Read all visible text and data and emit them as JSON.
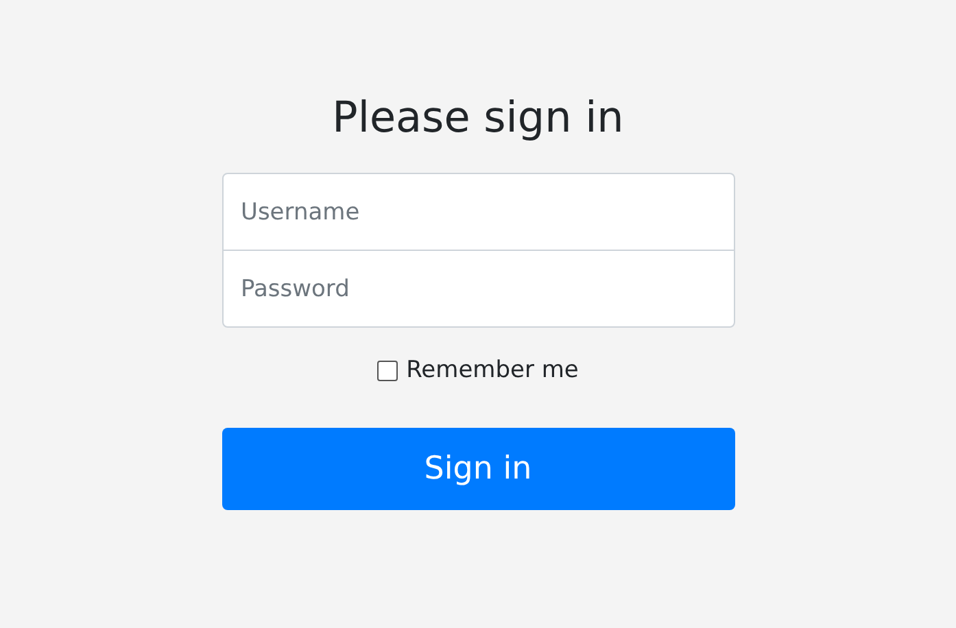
{
  "title": "Please sign in",
  "fields": [
    {
      "placeholder": "Username"
    },
    {
      "placeholder": "Password"
    }
  ],
  "remember": {
    "label": "Remember me",
    "checked": false
  },
  "button": "Sign in"
}
